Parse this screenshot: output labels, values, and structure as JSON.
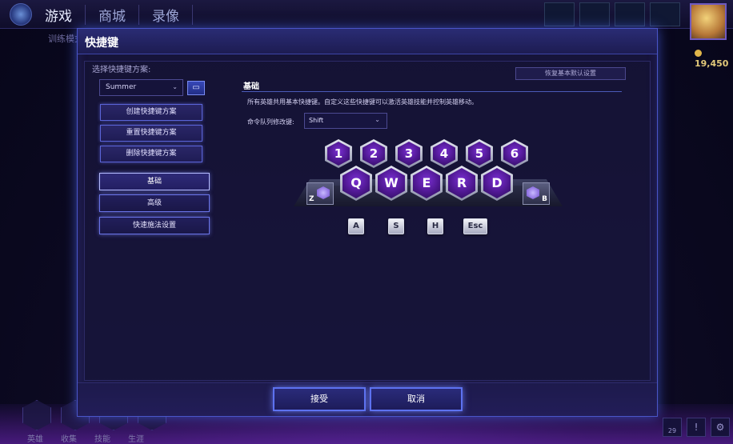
{
  "top_nav": {
    "items": [
      "游戏",
      "商城",
      "录像"
    ],
    "active_index": 0,
    "sub_text": "训练模式",
    "gold": "19,450"
  },
  "bottom_nav": {
    "labels": [
      "英雄",
      "收集",
      "技能",
      "生涯"
    ]
  },
  "right_icons": {
    "notification_count": "29"
  },
  "dialog": {
    "title": "快捷键",
    "scheme_label": "选择快捷键方案:",
    "scheme_selected": "Summer",
    "scheme_buttons": [
      "创建快捷键方案",
      "重置快捷键方案",
      "删除快捷键方案"
    ],
    "nav_buttons": [
      "基础",
      "高级",
      "快速施法设置"
    ],
    "selected_nav": "基础",
    "restore_button": "恢复基本默认设置",
    "section_title": "基础",
    "description": "所有英雄共用基本快捷键。自定义这些快捷键可以激活英雄技能并控制英雄移动。",
    "modifier_label": "命令队列修改键:",
    "modifier_value": "Shift",
    "keys_top": [
      "1",
      "2",
      "3",
      "4",
      "5",
      "6"
    ],
    "keys_mid": [
      "Q",
      "W",
      "E",
      "R",
      "D"
    ],
    "side_left": "Z",
    "side_right": "B",
    "keys_bottom": [
      "A",
      "S",
      "H",
      "Esc"
    ],
    "accept_button": "接受",
    "cancel_button": "取消"
  },
  "colors": {
    "accent": "#5d72f0",
    "key_face": "#4d178f",
    "gold": "#e2c97a"
  }
}
